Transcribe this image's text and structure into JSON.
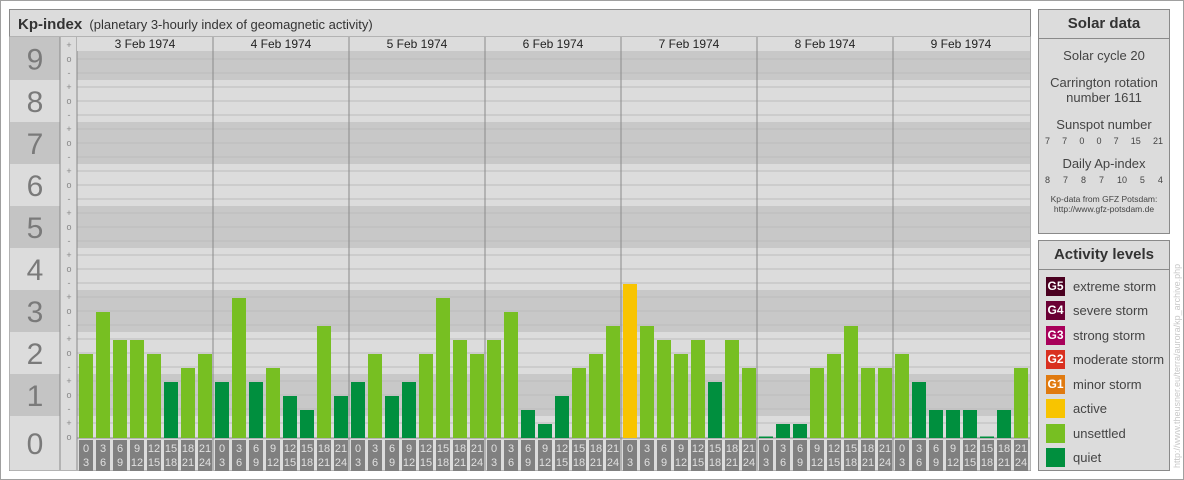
{
  "header": {
    "title": "Kp-index",
    "subtitle": "(planetary 3-hourly index of geomagnetic activity)"
  },
  "chart_data": {
    "type": "bar",
    "title": "Kp-index",
    "ylabel": "Kp",
    "ylim": [
      0,
      9
    ],
    "y_ticks": [
      "0",
      "1",
      "2",
      "3",
      "4",
      "5",
      "6",
      "7",
      "8",
      "9"
    ],
    "sub_ticks": [
      "-",
      "o",
      "+"
    ],
    "days": [
      "3 Feb 1974",
      "4 Feb 1974",
      "5 Feb 1974",
      "6 Feb 1974",
      "7 Feb 1974",
      "8 Feb 1974",
      "9 Feb 1974"
    ],
    "intervals": [
      [
        "0",
        "3"
      ],
      [
        "3",
        "6"
      ],
      [
        "6",
        "9"
      ],
      [
        "9",
        "12"
      ],
      [
        "12",
        "15"
      ],
      [
        "15",
        "18"
      ],
      [
        "18",
        "21"
      ],
      [
        "21",
        "24"
      ]
    ],
    "values_in_thirds": [
      [
        6,
        9,
        7,
        7,
        6,
        4,
        5,
        6
      ],
      [
        4,
        10,
        4,
        5,
        3,
        2,
        8,
        3
      ],
      [
        4,
        6,
        3,
        4,
        6,
        10,
        7,
        6
      ],
      [
        7,
        9,
        2,
        1,
        3,
        5,
        6,
        8
      ],
      [
        11,
        8,
        7,
        6,
        7,
        4,
        7,
        5
      ],
      [
        0,
        1,
        1,
        5,
        6,
        8,
        5,
        5
      ],
      [
        6,
        4,
        2,
        2,
        2,
        0,
        2,
        5
      ]
    ],
    "grid": true
  },
  "colors": {
    "quiet": "#008f3e",
    "unsettled": "#77bf22",
    "active": "#f8c400",
    "g1": "#e07a10",
    "g2": "#d93020",
    "g3": "#a8005a",
    "g4": "#6a0034",
    "g5": "#4a0020"
  },
  "solar": {
    "title": "Solar data",
    "cycle": "Solar cycle 20",
    "carrington1": "Carrington rotation",
    "carrington2": "number 1611",
    "sunspot_label": "Sunspot number",
    "sunspot": [
      "7",
      "7",
      "0",
      "0",
      "7",
      "15",
      "21"
    ],
    "ap_label": "Daily Ap-index",
    "ap": [
      "8",
      "7",
      "8",
      "7",
      "10",
      "5",
      "4"
    ],
    "source1": "Kp-data from GFZ Potsdam:",
    "source2": "http://www.gfz-potsdam.de"
  },
  "legend": {
    "title": "Activity levels",
    "items": [
      {
        "code": "G5",
        "label": "extreme storm",
        "color": "#4a0020"
      },
      {
        "code": "G4",
        "label": "severe storm",
        "color": "#6a0034"
      },
      {
        "code": "G3",
        "label": "strong storm",
        "color": "#a8005a"
      },
      {
        "code": "G2",
        "label": "moderate storm",
        "color": "#d93020"
      },
      {
        "code": "G1",
        "label": "minor storm",
        "color": "#e07a10"
      },
      {
        "code": "",
        "label": "active",
        "color": "#f8c400"
      },
      {
        "code": "",
        "label": "unsettled",
        "color": "#77bf22"
      },
      {
        "code": "",
        "label": "quiet",
        "color": "#008f3e"
      }
    ]
  },
  "watermark": "http://www.theusner.eu/terra/aurora/kp_archive.php"
}
